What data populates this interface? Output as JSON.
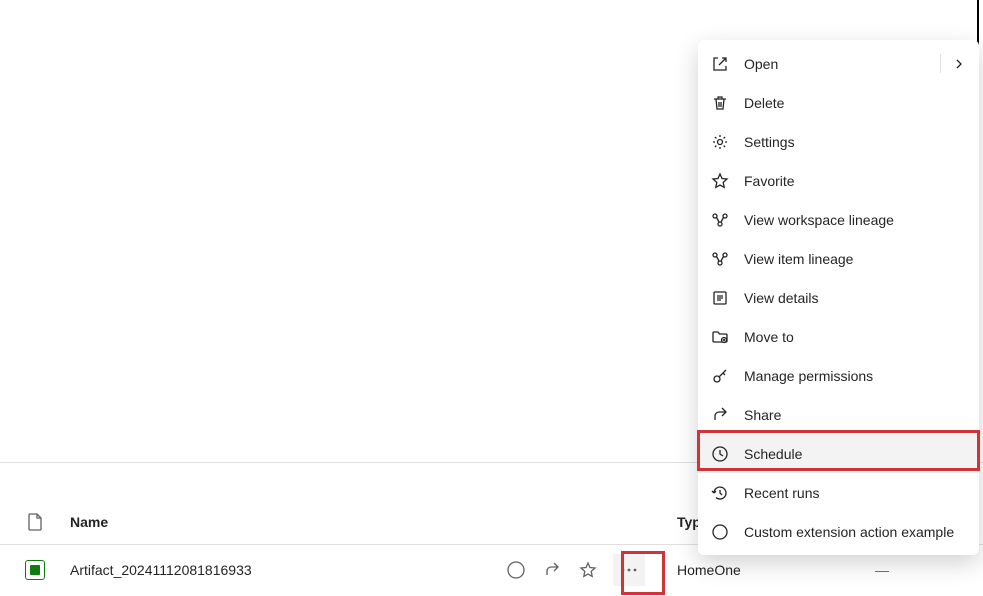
{
  "table": {
    "headers": {
      "name": "Name",
      "type": "Type"
    },
    "rows": [
      {
        "name": "Artifact_20241112081816933",
        "type": "HomeOne",
        "extra": "—"
      }
    ]
  },
  "contextMenu": {
    "items": [
      {
        "label": "Open",
        "icon": "open",
        "hasSubmenu": true
      },
      {
        "label": "Delete",
        "icon": "delete"
      },
      {
        "label": "Settings",
        "icon": "settings"
      },
      {
        "label": "Favorite",
        "icon": "favorite"
      },
      {
        "label": "View workspace lineage",
        "icon": "lineage"
      },
      {
        "label": "View item lineage",
        "icon": "lineage"
      },
      {
        "label": "View details",
        "icon": "details"
      },
      {
        "label": "Move to",
        "icon": "moveto"
      },
      {
        "label": "Manage permissions",
        "icon": "permissions"
      },
      {
        "label": "Share",
        "icon": "share"
      },
      {
        "label": "Schedule",
        "icon": "schedule",
        "highlighted": true
      },
      {
        "label": "Recent runs",
        "icon": "recent"
      },
      {
        "label": "Custom extension action example",
        "icon": "custom"
      }
    ]
  }
}
